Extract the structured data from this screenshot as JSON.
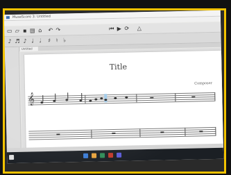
{
  "window": {
    "title": "MuseScore 3: Untitled"
  },
  "tabs": [
    {
      "label": "Untitled"
    }
  ],
  "score": {
    "title": "Title",
    "composer": "Composer"
  },
  "colors": {
    "border": "#f2c200",
    "selection": "#8ec7f0"
  }
}
